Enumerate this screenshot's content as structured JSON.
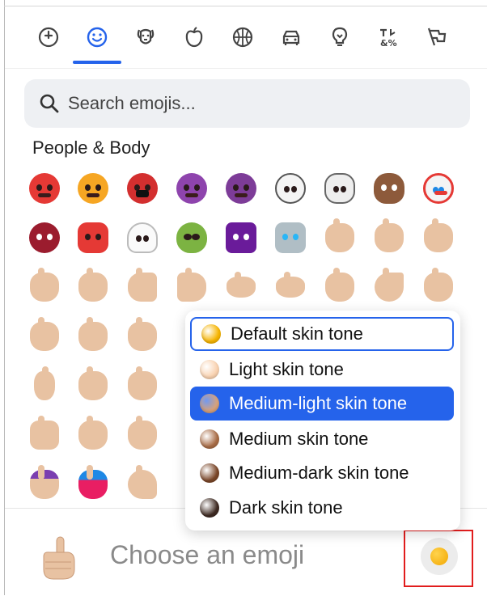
{
  "categories": [
    {
      "id": "recent",
      "icon": "clock-icon"
    },
    {
      "id": "people",
      "icon": "smiley-icon",
      "active": true
    },
    {
      "id": "animals",
      "icon": "dog-icon"
    },
    {
      "id": "food",
      "icon": "apple-icon"
    },
    {
      "id": "activities",
      "icon": "basketball-icon"
    },
    {
      "id": "travel",
      "icon": "car-icon"
    },
    {
      "id": "objects",
      "icon": "lightbulb-icon"
    },
    {
      "id": "symbols",
      "icon": "symbols-icon"
    },
    {
      "id": "flags",
      "icon": "flag-icon"
    }
  ],
  "search": {
    "placeholder": "Search emojis..."
  },
  "section": {
    "title": "People & Body"
  },
  "emoji_rows": [
    [
      "angry-face",
      "pouting-face",
      "face-with-symbols",
      "smiling-devil",
      "angry-devil",
      "skull",
      "skull-and-crossbones",
      "pile-of-poo",
      "clown-face"
    ],
    [
      "ogre",
      "goblin",
      "ghost",
      "alien",
      "alien-monster",
      "robot",
      "waving-hand",
      "raised-back-of-hand",
      "hand-with-fingers-splayed"
    ],
    [
      "raised-hand",
      "vulcan-salute",
      "rightwards-hand",
      "leftwards-hand",
      "palm-down-hand",
      "palm-up-hand",
      "ok-hand",
      "pinched-fingers",
      "pinching-hand"
    ],
    [
      "victory-hand",
      "crossed-fingers",
      "hand-with-index-finger-and-thumb-crossed",
      "",
      "",
      "",
      "",
      "",
      ""
    ],
    [
      "index-pointing-up",
      "backhand-index-pointing-down",
      "index-pointing-up-2",
      "",
      "",
      "",
      "",
      "",
      ""
    ],
    [
      "right-facing-fist",
      "clapping-hands",
      "raising-hands",
      "",
      "",
      "",
      "",
      "",
      ""
    ],
    [
      "nail-polish",
      "selfie",
      "flexed-biceps",
      "",
      "",
      "",
      "",
      "",
      ""
    ]
  ],
  "skin_tones": [
    {
      "label": "Default skin tone",
      "color": "#f7b500",
      "state": "focused"
    },
    {
      "label": "Light skin tone",
      "color": "#f9d2b0",
      "state": ""
    },
    {
      "label": "Medium-light skin tone",
      "color": "#d9a27a",
      "state": "selected"
    },
    {
      "label": "Medium skin tone",
      "color": "#a86c46",
      "state": ""
    },
    {
      "label": "Medium-dark skin tone",
      "color": "#7a4628",
      "state": ""
    },
    {
      "label": "Dark skin tone",
      "color": "#3e2a22",
      "state": ""
    }
  ],
  "footer": {
    "preview_text": "Choose an emoji",
    "preview_icon": "index-pointing-up-icon",
    "tone_button_icon": "default-skin-tone-icon"
  },
  "colors": {
    "accent": "#2563eb",
    "highlight": "#e11d1d",
    "skin_default": "#e8c2a2"
  }
}
